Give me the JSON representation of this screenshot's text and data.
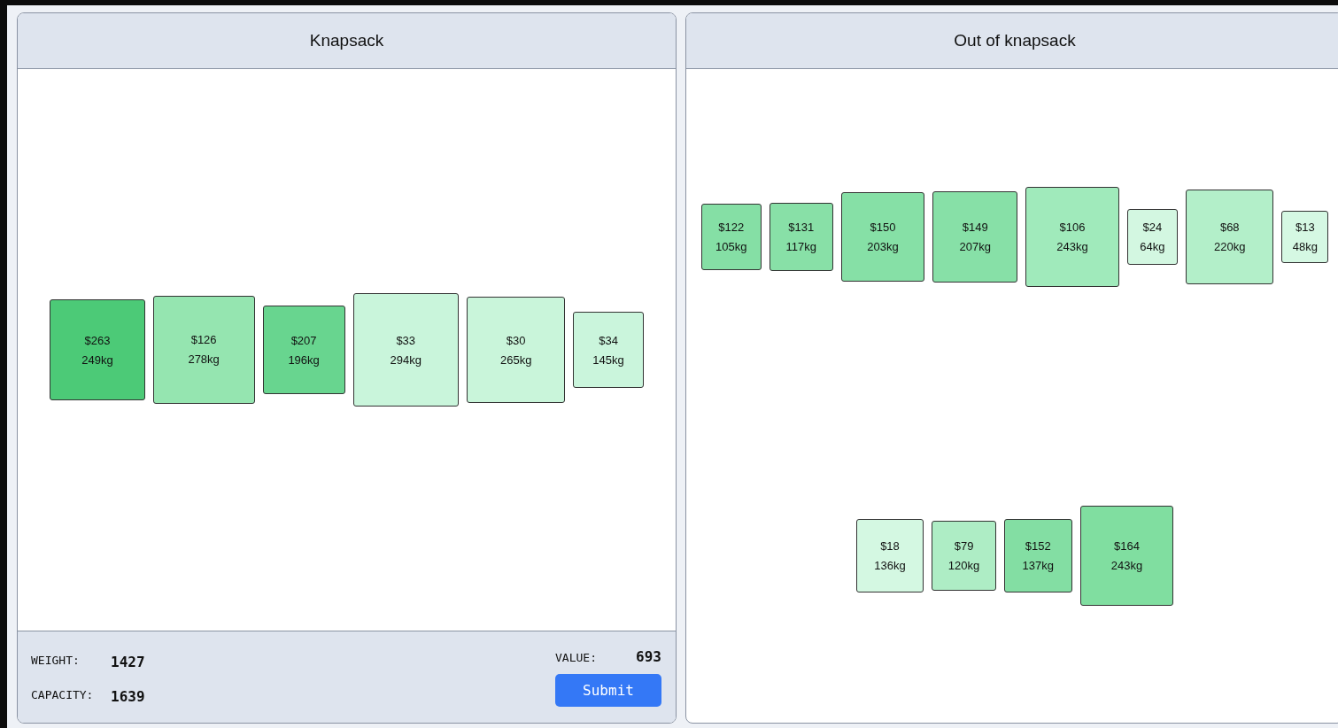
{
  "knapsack": {
    "title": "Knapsack",
    "items": [
      {
        "value": "$263",
        "weight": "249kg",
        "color": "#4cca77"
      },
      {
        "value": "$126",
        "weight": "278kg",
        "color": "#95e5b0"
      },
      {
        "value": "$207",
        "weight": "196kg",
        "color": "#68d58f"
      },
      {
        "value": "$33",
        "weight": "294kg",
        "color": "#c9f5db"
      },
      {
        "value": "$30",
        "weight": "265kg",
        "color": "#c9f5da"
      },
      {
        "value": "$34",
        "weight": "145kg",
        "color": "#caf5dc"
      }
    ],
    "footer": {
      "weight_label": "WEIGHT:",
      "weight": "1427",
      "capacity_label": "CAPACITY:",
      "capacity": "1639",
      "value_label": "VALUE:",
      "value": "693",
      "submit": "Submit"
    }
  },
  "out_of_knapsack": {
    "title": "Out of knapsack",
    "items": [
      {
        "value": "$122",
        "weight": "105kg",
        "color": "#85dfa5"
      },
      {
        "value": "$131",
        "weight": "117kg",
        "color": "#88e0a7"
      },
      {
        "value": "$150",
        "weight": "203kg",
        "color": "#86e0a6"
      },
      {
        "value": "$149",
        "weight": "207kg",
        "color": "#87e0a7"
      },
      {
        "value": "$106",
        "weight": "243kg",
        "color": "#a0eabb"
      },
      {
        "value": "$24",
        "weight": "64kg",
        "color": "#d3f7e1"
      },
      {
        "value": "$68",
        "weight": "220kg",
        "color": "#b3efc9"
      },
      {
        "value": "$13",
        "weight": "48kg",
        "color": "#d5f8e3"
      },
      {
        "value": "$18",
        "weight": "136kg",
        "color": "#d4f8e2"
      },
      {
        "value": "$79",
        "weight": "120kg",
        "color": "#aeedc5"
      },
      {
        "value": "$152",
        "weight": "137kg",
        "color": "#83dea3"
      },
      {
        "value": "$164",
        "weight": "243kg",
        "color": "#80dea0"
      }
    ]
  }
}
